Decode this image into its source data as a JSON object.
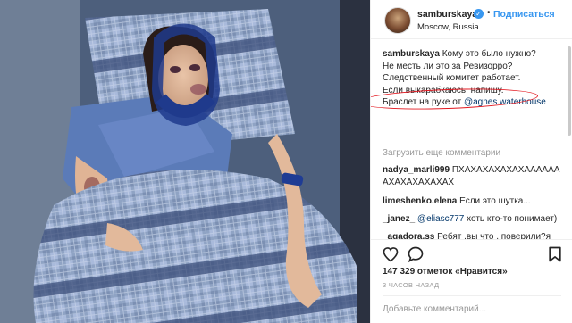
{
  "header": {
    "username": "samburskaya",
    "verified_glyph": "✓",
    "separator": "•",
    "follow_label": "Подписаться",
    "location": "Moscow, Russia"
  },
  "caption": {
    "username": "samburskaya",
    "lines": [
      "Кому это было нужно?",
      "Не месть ли это за Ревизорро?",
      "Следственный комитет работает.",
      "Если выкарабкаюсь, напишу.",
      "Браслет на руке от"
    ],
    "mention": "@agnes.waterhouse"
  },
  "load_more_label": "Загрузить еще комментарии",
  "comments": [
    {
      "user": "nadya_marli999",
      "text": "ПХАХАХАХАХАХАААААА АХАХАХАХАХАХ"
    },
    {
      "user": "limeshenko.elena",
      "text": "Если это шутка..."
    },
    {
      "user": "_janez_",
      "mention": "@eliasc777",
      "text": "хоть кто-то понимает)"
    },
    {
      "user": "_agadora.ss",
      "text": "Ребят ,вы что , поверили?я спрашиваю у некоторых☐,если бы это было по настоящему,никто бы больного человека не снимал☐☐господи..."
    }
  ],
  "likes_text": "147 329 отметок «Нравится»",
  "time_text": "3 ЧАСОВ НАЗАД",
  "add_comment_placeholder": "Добавьте комментарий...",
  "icons": [
    "heart-icon",
    "comment-icon",
    "bookmark-icon",
    "verified-badge-icon"
  ],
  "colors": {
    "link": "#3897f0",
    "mention": "#003569",
    "annotation": "#e3171f",
    "muted": "#999999"
  }
}
